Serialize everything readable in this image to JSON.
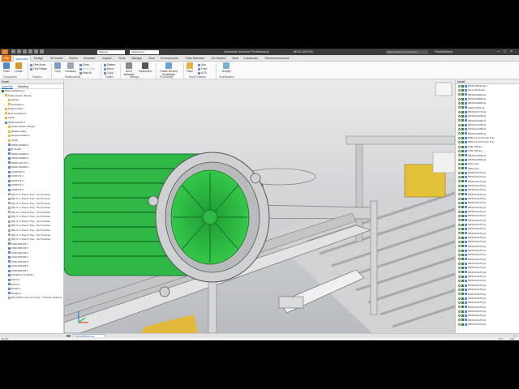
{
  "titlebar": {
    "logo": "I PRO",
    "design_combo": "Material",
    "appearance_combo": "Appearance",
    "app_title": "Autodesk Inventor Professional",
    "file_name": "MOD-000194",
    "search_placeholder": "Search Help & Commands...",
    "user": "PaulMathest"
  },
  "tabs": [
    "File",
    "Assemble",
    "Design",
    "3D Model",
    "Sketch",
    "Annotate",
    "Inspect",
    "Tools",
    "Manage",
    "View",
    "Environments",
    "Data Standard",
    "Get Started",
    "Vault",
    "Collaborate",
    "Electromechanical"
  ],
  "ribbon": {
    "place": "Place",
    "create": "Create",
    "show": "Show",
    "show_sick": "Show Sick",
    "hide_all": "Hide All",
    "free_move": "Free Move",
    "free_rotate": "Free Rotate",
    "joint": "Joint",
    "constrain": "Constrain",
    "pattern": "Pattern",
    "mirror": "Mirror",
    "copy": "Copy",
    "bill_of_materials": "Bill of Materials",
    "parameters": "Parameters",
    "create_derived": "Create Derived Substitutes",
    "plane": "Plane",
    "axis": "Axis",
    "point": "Point",
    "ucs": "UCS",
    "simplify": "Simplify",
    "panels": [
      "Component",
      "Position",
      "Relationships",
      "Pattern",
      "Manage",
      "Productivity",
      "Work Features",
      "Simplification"
    ]
  },
  "browser": {
    "header": "Model",
    "tabs": [
      "Assembly",
      "Modeling"
    ],
    "items": [
      "MOD-000194.iam",
      "Model States: Master",
      "Master",
      "Substitutes",
      "Relationships",
      "Representations",
      "Origin",
      "MOD-000194:1",
      "Model States: Master",
      "Relationships",
      "Representations",
      "Origin",
      "M036-011893:1",
      "B-10-4M",
      "M036-011828:1",
      "M036-011883:1",
      "M036-011776:1",
      "M036-011258:1",
      "A4040401:1",
      "A003713:1",
      "A003713:2",
      "A003313:1",
      "A003313:2",
      "[M] 17 in Pouch Tray - No Pouches",
      "[M] 17 in Pouch Tray - No Pouches",
      "[M] 17 in Pouch Tray - No Pouches",
      "[M] 17 in Pouch Tray - No Pouches",
      "[M] 17 in Pouch Tray - No Pouches",
      "[M] 17 in Pouch Tray - No Pouches",
      "[M] 17 in Pouch Tray - No Pouches",
      "[M] 17 in Pouch Tray - No Pouches",
      "[M] 17 in Pouch Tray - No Pouches",
      "[M] 17 in Pouch Tray - No Pouches",
      "[M] 17 in Pouch Tray - No Pouches",
      "2049-000193:1",
      "2049-000193:2",
      "2049-000193:3",
      "2049-000193:4",
      "2049-000193:5",
      "2049-000193:6",
      "2049-000193:7",
      "FlexBot-L2.5-2000:1",
      "Plinth:1",
      "Plinth:2",
      "Rotate:1",
      "Rotate:2",
      "[M] A3019 In Pouch Trays - 0-Kinetic Stations"
    ]
  },
  "right_panel": {
    "header": "Model",
    "items": [
      "MOD-000194.iam",
      "FlexU-2019.iam",
      "M036-011893.ipt",
      "M036-011828.ipt",
      "M036-011883.ipt",
      "A0022-1001.ipt",
      "M036-011776.ipt",
      "M036-011258.ipt",
      "M036-011258.ipt",
      "M036-011255.ipt",
      "M036-011258.ipt",
      "M036-011893.ipt",
      "MRD-12 Hot Pouch Tray",
      "MRD-11 Hot Pouch Tray",
      "SUB-105.iam",
      "SUB-105.iam",
      "M036-011893.ipt",
      "M036-011893.ipt",
      "Slides.iam",
      "Slides.iam",
      "M036-011176.ipt",
      "M036-011176.ipt",
      "M036-011176.ipt",
      "M036-011176.ipt",
      "M036-011176.ipt",
      "M036-011176.ipt",
      "M036-011176.ipt",
      "M036-011176.ipt",
      "M036-011176.ipt",
      "M036-011176.ipt",
      "M036-011176.ipt",
      "M036-011176.ipt",
      "M036-011176.ipt",
      "M036-011176.ipt",
      "M036-011176.ipt",
      "M036-011176.ipt",
      "M036-011176.ipt",
      "M036-011176.ipt",
      "M036-011176.ipt",
      "M036-011176.ipt",
      "M036-011176.ipt",
      "M036-011176.ipt",
      "M036-011176.ipt",
      "M036-011176.ipt",
      "M036-011176.ipt",
      "M036-011176.ipt",
      "M036-011176.ipt",
      "M036-011176.ipt",
      "M036-011176.ipt",
      "M036-011176.ipt",
      "M036-011176.ipt",
      "M036-011176.ipt",
      "M036-011176.ipt",
      "M036-011176.ipt",
      "M036-011176.ipt",
      "M036-011176.ipt"
    ]
  },
  "doc_tab": "MOD-000194.iam",
  "status": {
    "ready": "Ready",
    "count1": "461",
    "count2": "190"
  },
  "colors": {
    "motor": "#2fb845",
    "frame": "#c9cbcd",
    "accent": "#e07b1f",
    "active_tab": "#1565c0"
  }
}
